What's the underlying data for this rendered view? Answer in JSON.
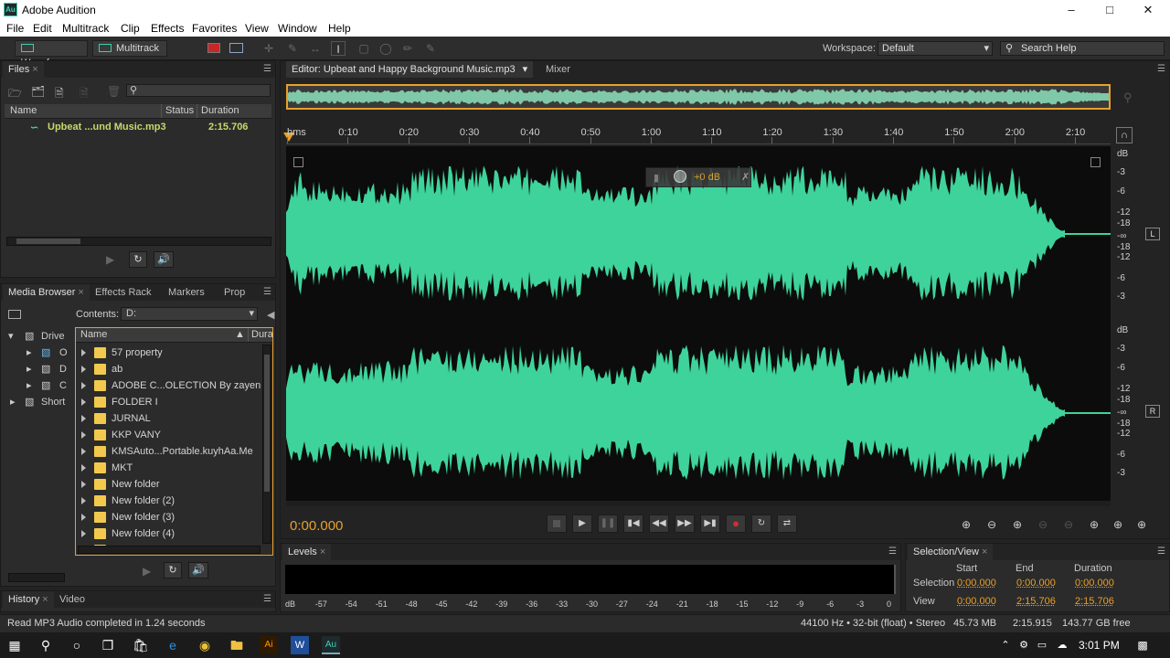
{
  "window": {
    "title": "Adobe Audition",
    "icon_text": "Au"
  },
  "menu": [
    "File",
    "Edit",
    "Multitrack",
    "Clip",
    "Effects",
    "Favorites",
    "View",
    "Window",
    "Help"
  ],
  "toolbar": {
    "waveform_label": "Waveform",
    "multitrack_label": "Multitrack",
    "workspace_label": "Workspace:",
    "workspace_value": "Default",
    "search_placeholder": "Search Help"
  },
  "files_panel": {
    "tab": "Files",
    "columns": {
      "name": "Name",
      "status": "Status",
      "duration": "Duration"
    },
    "file": {
      "name": "Upbeat ...und Music.mp3",
      "duration": "2:15.706"
    }
  },
  "media_browser": {
    "tabs": [
      "Media Browser",
      "Effects Rack",
      "Markers",
      "Prop"
    ],
    "contents_label": "Contents:",
    "contents_value": "D:",
    "tree": [
      "Drive",
      "O",
      "D",
      "C",
      "Short"
    ],
    "columns": {
      "name": "Name",
      "duration": "Dura"
    },
    "folders": [
      "57 property",
      "ab",
      "ADOBE C...OLECTION By zayen",
      "FOLDER I",
      "JURNAL",
      "KKP VANY",
      "KMSAuto...Portable.kuyhAa.Me",
      "MKT",
      "New folder",
      "New folder (2)",
      "New folder (3)",
      "New folder (4)",
      "PROJECT SKRIPSI"
    ]
  },
  "history_panel": {
    "tabs": [
      "History",
      "Video"
    ]
  },
  "editor": {
    "tab": "Editor: Upbeat and Happy Background Music.mp3",
    "mixer_tab": "Mixer",
    "ruler": [
      "hms",
      "0:10",
      "0:20",
      "0:30",
      "0:40",
      "0:50",
      "1:00",
      "1:10",
      "1:20",
      "1:30",
      "1:40",
      "1:50",
      "2:00",
      "2:10"
    ],
    "db_scale": [
      "dB",
      "-3",
      "-6",
      "-12",
      "-18",
      "-∞",
      "-18",
      "-12",
      "-6",
      "-3"
    ],
    "channel_left": "L",
    "channel_right": "R",
    "hud_gain": "+0 dB",
    "time": "0:00.000"
  },
  "levels": {
    "tab": "Levels",
    "scale": [
      "dB",
      "-57",
      "-54",
      "-51",
      "-48",
      "-45",
      "-42",
      "-39",
      "-36",
      "-33",
      "-30",
      "-27",
      "-24",
      "-21",
      "-18",
      "-15",
      "-12",
      "-9",
      "-6",
      "-3",
      "0"
    ]
  },
  "selection_view": {
    "tab": "Selection/View",
    "headers": [
      "Start",
      "End",
      "Duration"
    ],
    "selection_label": "Selection",
    "view_label": "View",
    "selection": [
      "0:00.000",
      "0:00.000",
      "0:00.000"
    ],
    "view": [
      "0:00.000",
      "2:15.706",
      "2:15.706"
    ]
  },
  "status": {
    "message": "Read MP3 Audio completed in 1.24 seconds",
    "format": "44100 Hz • 32-bit (float) • Stereo",
    "size": "45.73 MB",
    "duration": "2:15.915",
    "free": "143.77 GB free"
  },
  "taskbar": {
    "time": "3:01 PM"
  },
  "colors": {
    "wave": "#3ed39b",
    "accent_orange": "#e8a02a",
    "bg": "#232323"
  }
}
